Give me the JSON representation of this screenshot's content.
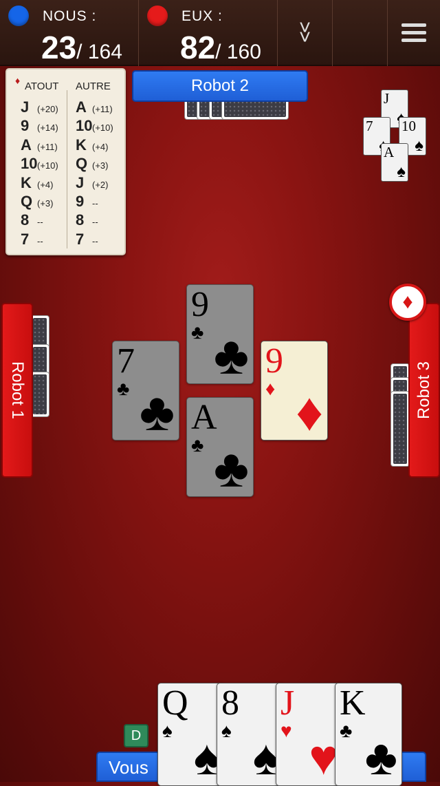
{
  "topbar": {
    "team_us": {
      "name": "NOUS :",
      "score": "23",
      "total": "/ 164",
      "color": "#1565e8"
    },
    "team_them": {
      "name": "EUX :",
      "score": "82",
      "total": "/ 160",
      "color": "#e51b1b"
    },
    "collapse_icon": "double-chevron-down-icon",
    "menu_icon": "hamburger-menu-icon"
  },
  "scorecard": {
    "trump_suit_icon": "diamond-icon",
    "header_trump": "ATOUT",
    "header_other": "AUTRE",
    "trump_rows": [
      {
        "rank": "J",
        "pts": "(+20)"
      },
      {
        "rank": "9",
        "pts": "(+14)"
      },
      {
        "rank": "A",
        "pts": "(+11)"
      },
      {
        "rank": "10",
        "pts": "(+10)"
      },
      {
        "rank": "K",
        "pts": "(+4)"
      },
      {
        "rank": "Q",
        "pts": "(+3)"
      },
      {
        "rank": "8",
        "pts": "--"
      },
      {
        "rank": "7",
        "pts": "--"
      }
    ],
    "other_rows": [
      {
        "rank": "A",
        "pts": "(+11)"
      },
      {
        "rank": "10",
        "pts": "(+10)"
      },
      {
        "rank": "K",
        "pts": "(+4)"
      },
      {
        "rank": "Q",
        "pts": "(+3)"
      },
      {
        "rank": "J",
        "pts": "(+2)"
      },
      {
        "rank": "9",
        "pts": "--"
      },
      {
        "rank": "8",
        "pts": "--"
      },
      {
        "rank": "7",
        "pts": "--"
      }
    ]
  },
  "players": {
    "top": "Robot 2",
    "left": "Robot 1",
    "right": "Robot 3",
    "bottom": "Vous"
  },
  "last_trick": [
    {
      "rank": "J",
      "suit": "♠"
    },
    {
      "rank": "7",
      "suit": "♠"
    },
    {
      "rank": "10",
      "suit": "♠"
    },
    {
      "rank": "A",
      "suit": "♠"
    }
  ],
  "table_cards": {
    "top": {
      "rank": "9",
      "suit": "♣"
    },
    "left": {
      "rank": "7",
      "suit": "♣"
    },
    "bottom": {
      "rank": "A",
      "suit": "♣"
    },
    "right": {
      "rank": "9",
      "suit": "♦"
    }
  },
  "trump_badge": {
    "suit": "♦",
    "icon": "diamond-icon"
  },
  "dealer_badge": "D",
  "hand": [
    {
      "rank": "Q",
      "suit": "♠"
    },
    {
      "rank": "8",
      "suit": "♠"
    },
    {
      "rank": "J",
      "suit": "♥"
    },
    {
      "rank": "K",
      "suit": "♣"
    }
  ]
}
